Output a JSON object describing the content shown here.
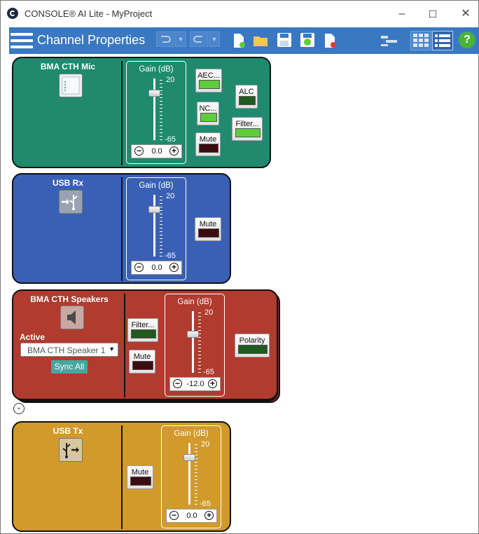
{
  "window": {
    "title": "CONSOLE® AI Lite - MyProject",
    "minimize": "–",
    "maximize": "☐",
    "close": "✕"
  },
  "toolbar": {
    "title": "Channel Properties",
    "help": "?"
  },
  "panels": [
    {
      "name": "BMA CTH Mic",
      "gain": {
        "label": "Gain  (dB)",
        "max": "20",
        "min": "-65",
        "value": "0.0",
        "level": 0.765
      },
      "buttons": [
        {
          "label": "AEC...",
          "led": "green"
        },
        {
          "label": "NC...",
          "led": "green"
        },
        {
          "label": "Mute",
          "led": "dark"
        },
        {
          "label": "ALC",
          "led": "dkgreen"
        },
        {
          "label": "Filter...",
          "led": "green"
        }
      ],
      "color": "#1f8a6e"
    },
    {
      "name": "USB Rx",
      "gain": {
        "label": "Gain  (dB)",
        "max": "20",
        "min": "-65",
        "value": "0.0",
        "level": 0.765
      },
      "buttons": [
        {
          "label": "Mute",
          "led": "dark"
        }
      ],
      "color": "#3a60b5"
    },
    {
      "name": "BMA CTH Speakers",
      "active_label": "Active",
      "active_value": "BMA CTH Speaker 1",
      "sync_label": "Sync All",
      "gain": {
        "label": "Gain  (dB)",
        "max": "20",
        "min": "-65",
        "value": "-12.0",
        "level": 0.624
      },
      "buttons": [
        {
          "label": "Filter...",
          "led": "dkgreen"
        },
        {
          "label": "Mute",
          "led": "dark"
        },
        {
          "label": "Polarity",
          "led": "dkgreen"
        }
      ],
      "color": "#b03b2e"
    },
    {
      "name": "USB Tx",
      "gain": {
        "label": "Gain  (dB)",
        "max": "20",
        "min": "-65",
        "value": "0.0",
        "level": 0.765
      },
      "buttons": [
        {
          "label": "Mute",
          "led": "dark"
        }
      ],
      "color": "#d19a2a"
    }
  ]
}
